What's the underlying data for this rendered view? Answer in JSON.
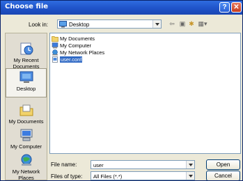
{
  "window": {
    "title": "Choose file"
  },
  "lookin": {
    "label": "Look in:",
    "value": "Desktop"
  },
  "places": [
    {
      "label": "My Recent Documents",
      "icon": "recent-documents-icon"
    },
    {
      "label": "Desktop",
      "icon": "desktop-icon"
    },
    {
      "label": "My Documents",
      "icon": "my-documents-icon"
    },
    {
      "label": "My Computer",
      "icon": "my-computer-icon"
    },
    {
      "label": "My Network Places",
      "icon": "network-places-icon"
    }
  ],
  "files": [
    {
      "name": "My Documents",
      "icon": "folder-icon"
    },
    {
      "name": "My Computer",
      "icon": "computer-icon"
    },
    {
      "name": "My Network Places",
      "icon": "network-icon"
    },
    {
      "name": "user.conf",
      "icon": "file-icon"
    }
  ],
  "filename": {
    "label": "File name:",
    "value": "user"
  },
  "filetype": {
    "label": "Files of type:",
    "value": "All Files (*.*)"
  },
  "buttons": {
    "open": "Open",
    "cancel": "Cancel"
  }
}
